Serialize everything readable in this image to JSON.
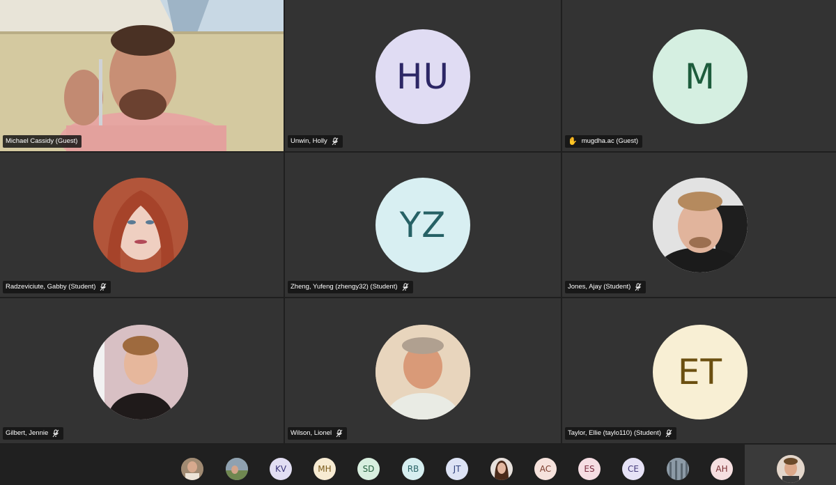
{
  "participants": [
    {
      "name": "Michael Cassidy (Guest)",
      "type": "video",
      "mic": "none"
    },
    {
      "name": "Unwin, Holly",
      "type": "initials",
      "initials": "HU",
      "bg": "#e0dcf3",
      "fg": "#2c2665",
      "mic": "muted"
    },
    {
      "name": "mugdha.ac (Guest)",
      "type": "initials",
      "initials": "M",
      "bg": "#d5efe1",
      "fg": "#1d5c3c",
      "mic": "none",
      "hand_raised": true
    },
    {
      "name": "Radzeviciute, Gabby (Student)",
      "type": "photo",
      "mic": "muted"
    },
    {
      "name": "Zheng, Yufeng (zhengy32) (Student)",
      "type": "initials",
      "initials": "YZ",
      "bg": "#d8eff2",
      "fg": "#266165",
      "mic": "muted"
    },
    {
      "name": "Jones, Ajay (Student)",
      "type": "photo",
      "mic": "muted"
    },
    {
      "name": "Gilbert, Jennie",
      "type": "photo",
      "mic": "muted"
    },
    {
      "name": "Wilson, Lionel",
      "type": "photo",
      "mic": "muted"
    },
    {
      "name": "Taylor, Ellie (taylo110) (Student)",
      "type": "initials",
      "initials": "ET",
      "bg": "#f8efd4",
      "fg": "#6b4f10",
      "mic": "muted"
    }
  ],
  "roster": [
    {
      "initials": "",
      "type": "photo"
    },
    {
      "initials": "",
      "type": "photo"
    },
    {
      "initials": "KV",
      "bg": "#e2def3"
    },
    {
      "initials": "MH",
      "bg": "#f7ebd2"
    },
    {
      "initials": "SD",
      "bg": "#d8efdf"
    },
    {
      "initials": "RB",
      "bg": "#d6eef0"
    },
    {
      "initials": "JT",
      "bg": "#dde3f5"
    },
    {
      "initials": "",
      "type": "photo"
    },
    {
      "initials": "AC",
      "bg": "#f6e2dc"
    },
    {
      "initials": "ES",
      "bg": "#f6dde3"
    },
    {
      "initials": "CE",
      "bg": "#e6e2f6"
    },
    {
      "initials": "",
      "type": "photo"
    },
    {
      "initials": "AH",
      "bg": "#f6dfe0"
    }
  ]
}
